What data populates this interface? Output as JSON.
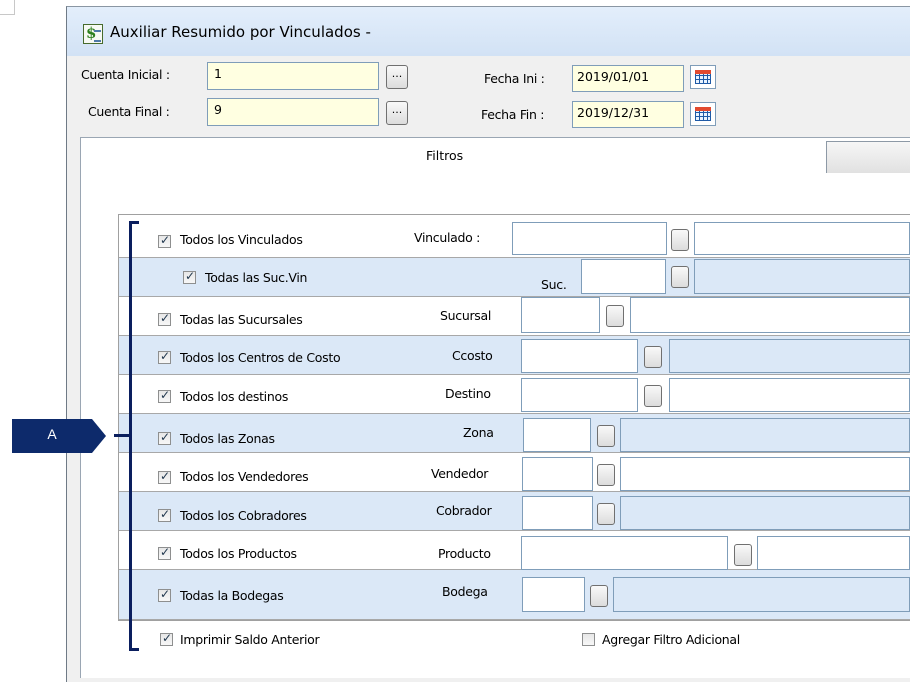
{
  "window": {
    "title": "Auxiliar Resumido por Vinculados -"
  },
  "header": {
    "cuenta_inicial_label": "Cuenta Inicial :",
    "cuenta_inicial_value": "1",
    "cuenta_final_label": "Cuenta Final :",
    "cuenta_final_value": "9",
    "fecha_ini_label": "Fecha Ini :",
    "fecha_ini_value": "2019/01/01",
    "fecha_fin_label": "Fecha Fin :",
    "fecha_fin_value": "2019/12/31",
    "browse_label": "..."
  },
  "tabs": {
    "filtros_label": "Filtros"
  },
  "filters": {
    "vinculados": {
      "checkbox_label": "Todos los Vinculados",
      "field_label": "Vinculado :",
      "checked": true
    },
    "suc_vin": {
      "checkbox_label": "Todas las Suc.Vin",
      "field_label": "Suc.",
      "checked": true
    },
    "sucursales": {
      "checkbox_label": "Todas las Sucursales",
      "field_label": "Sucursal",
      "checked": true
    },
    "centros_costo": {
      "checkbox_label": "Todos los Centros de Costo",
      "field_label": "Ccosto",
      "checked": true
    },
    "destinos": {
      "checkbox_label": "Todos los destinos",
      "field_label": "Destino",
      "checked": true
    },
    "zonas": {
      "checkbox_label": "Todos las Zonas",
      "field_label": "Zona",
      "checked": true
    },
    "vendedores": {
      "checkbox_label": "Todos los Vendedores",
      "field_label": "Vendedor",
      "checked": true
    },
    "cobradores": {
      "checkbox_label": "Todos los Cobradores",
      "field_label": "Cobrador",
      "checked": true
    },
    "productos": {
      "checkbox_label": "Todos los Productos",
      "field_label": "Producto",
      "checked": true
    },
    "bodegas": {
      "checkbox_label": "Todas la Bodegas",
      "field_label": "Bodega",
      "checked": true
    }
  },
  "options": {
    "imprimir_saldo_anterior": {
      "label": "Imprimir Saldo Anterior",
      "checked": true
    },
    "agregar_filtro_adicional": {
      "label": "Agregar Filtro Adicional",
      "checked": false
    }
  },
  "annotation": {
    "callout_label": "A",
    "color": "#0d2a6b"
  },
  "colors": {
    "row_blue": "#dbe8f7",
    "input_yellow": "#ffffe1",
    "title_bar": "#dae7f6"
  }
}
